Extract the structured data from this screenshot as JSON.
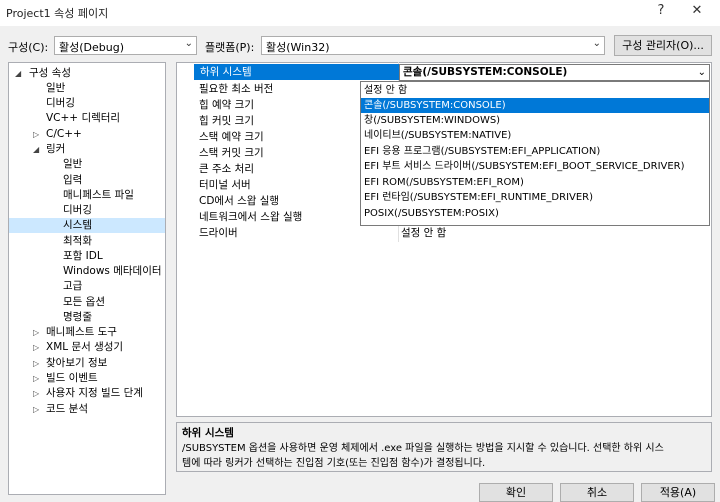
{
  "window": {
    "title": "Project1 속성 페이지",
    "help": "?",
    "close": "✕"
  },
  "config": {
    "label": "구성(C):",
    "value": "활성(Debug)",
    "platform_label": "플랫폼(P):",
    "platform_value": "활성(Win32)",
    "manager_button": "구성 관리자(O)..."
  },
  "tree": {
    "root": "구성 속성",
    "items": [
      {
        "label": "일반"
      },
      {
        "label": "디버깅"
      },
      {
        "label": "VC++ 디렉터리"
      },
      {
        "label": "C/C++"
      },
      {
        "label": "링커"
      },
      {
        "label": "일반"
      },
      {
        "label": "입력"
      },
      {
        "label": "매니페스트 파일"
      },
      {
        "label": "디버깅"
      },
      {
        "label": "시스템"
      },
      {
        "label": "최적화"
      },
      {
        "label": "포함 IDL"
      },
      {
        "label": "Windows 메타데이터"
      },
      {
        "label": "고급"
      },
      {
        "label": "모든 옵션"
      },
      {
        "label": "명령줄"
      },
      {
        "label": "매니페스트 도구"
      },
      {
        "label": "XML 문서 생성기"
      },
      {
        "label": "찾아보기 정보"
      },
      {
        "label": "빌드 이벤트"
      },
      {
        "label": "사용자 지정 빌드 단계"
      },
      {
        "label": "코드 분석"
      }
    ]
  },
  "grid": {
    "selected_name": "하위 시스템",
    "selected_value": "콘솔(/SUBSYSTEM:CONSOLE)",
    "rows": [
      {
        "name": "필요한 최소 버전",
        "value": ""
      },
      {
        "name": "힙 예약 크기",
        "value": ""
      },
      {
        "name": "힙 커밋 크기",
        "value": ""
      },
      {
        "name": "스택 예약 크기",
        "value": ""
      },
      {
        "name": "스택 커밋 크기",
        "value": ""
      },
      {
        "name": "큰 주소 처리",
        "value": ""
      },
      {
        "name": "터미널 서버",
        "value": ""
      },
      {
        "name": "CD에서 스왑 실행",
        "value": ""
      },
      {
        "name": "네트워크에서 스왑 실행",
        "value": ""
      },
      {
        "name": "드라이버",
        "value": "설정 안 함"
      }
    ]
  },
  "dropdown": {
    "options": [
      "설정 안 함",
      "콘솔(/SUBSYSTEM:CONSOLE)",
      "창(/SUBSYSTEM:WINDOWS)",
      "네이티브(/SUBSYSTEM:NATIVE)",
      "EFI 응용 프로그램(/SUBSYSTEM:EFI_APPLICATION)",
      "EFI 부트 서비스 드라이버(/SUBSYSTEM:EFI_BOOT_SERVICE_DRIVER)",
      "EFI ROM(/SUBSYSTEM:EFI_ROM)",
      "EFI 런타임(/SUBSYSTEM:EFI_RUNTIME_DRIVER)",
      "POSIX(/SUBSYSTEM:POSIX)"
    ],
    "highlighted": 1
  },
  "description": {
    "title": "하위 시스템",
    "line1": "/SUBSYSTEM 옵션을 사용하면 운영 체제에서 .exe 파일을 실행하는 방법을 지시할 수 있습니다. 선택한 하위 시스",
    "line2": "템에 따라 링커가 선택하는 진입점 기호(또는 진입점 함수)가 결정됩니다."
  },
  "buttons": {
    "ok": "확인",
    "cancel": "취소",
    "apply": "적용(A)"
  },
  "colors": {
    "selection": "#0078d7",
    "tree_selection": "#cce8ff"
  }
}
